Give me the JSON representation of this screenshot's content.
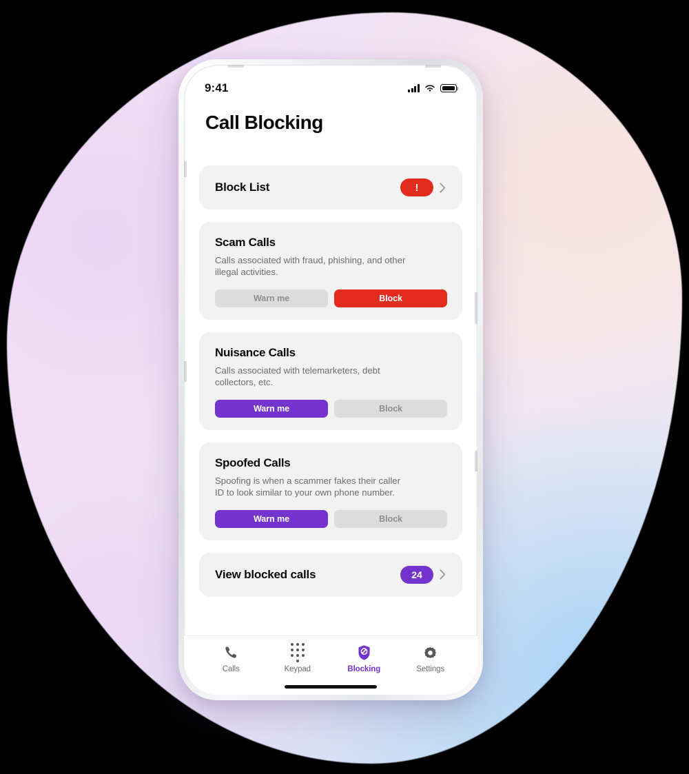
{
  "background": {
    "blob_colors": [
      "#f0dcf6",
      "#fae4e0",
      "#c7dcf3"
    ]
  },
  "theme": {
    "accent_purple": "#7433cc",
    "danger_red": "#e32b20",
    "card_bg": "#f2f2f2",
    "inactive_seg": "#dcdcdc"
  },
  "status_bar": {
    "time": "9:41",
    "signal_icon": "cellular-signal-icon",
    "wifi_icon": "wifi-icon",
    "battery_icon": "battery-icon"
  },
  "header": {
    "title": "Call Blocking"
  },
  "block_list_row": {
    "label": "Block List",
    "badge": "!",
    "chevron_icon": "chevron-right-icon"
  },
  "categories": [
    {
      "title": "Scam Calls",
      "description": "Calls associated with fraud, phishing, and other illegal activities.",
      "warn_label": "Warn me",
      "block_label": "Block",
      "selected": "block"
    },
    {
      "title": "Nuisance Calls",
      "description": "Calls associated with telemarketers, debt collectors, etc.",
      "warn_label": "Warn me",
      "block_label": "Block",
      "selected": "warn"
    },
    {
      "title": "Spoofed Calls",
      "description": "Spoofing is when a scammer fakes their caller ID to look similar to your own phone number.",
      "warn_label": "Warn me",
      "block_label": "Block",
      "selected": "warn"
    }
  ],
  "view_blocked_row": {
    "label": "View blocked calls",
    "badge": "24",
    "chevron_icon": "chevron-right-icon"
  },
  "tabbar": {
    "tabs": [
      {
        "label": "Calls",
        "icon": "phone-icon",
        "active": false
      },
      {
        "label": "Keypad",
        "icon": "keypad-icon",
        "active": false
      },
      {
        "label": "Blocking",
        "icon": "shield-block-icon",
        "active": true
      },
      {
        "label": "Settings",
        "icon": "gear-icon",
        "active": false
      }
    ]
  }
}
